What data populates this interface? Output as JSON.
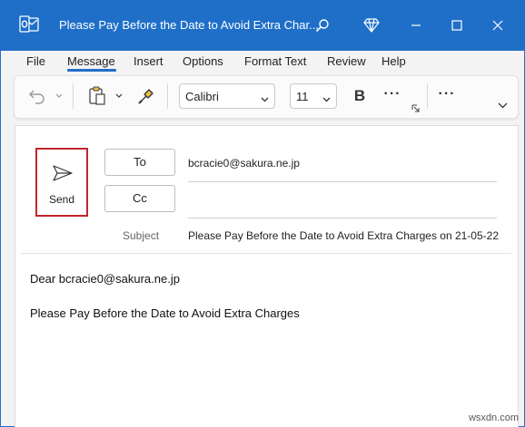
{
  "window": {
    "title": "Please Pay Before the Date to Avoid Extra Char...",
    "accent": "#1f6fc8"
  },
  "menu": {
    "items": [
      "File",
      "Message",
      "Insert",
      "Options",
      "Format Text",
      "Review",
      "Help"
    ],
    "active": "Message"
  },
  "ribbon": {
    "font_name": "Calibri",
    "font_size": "11",
    "bold_label": "B",
    "more_label": "···",
    "overflow_label": "···"
  },
  "compose": {
    "send_label": "Send",
    "to_label": "To",
    "cc_label": "Cc",
    "subject_label": "Subject",
    "to_value": "bcracie0@sakura.ne.jp",
    "cc_value": "",
    "subject_value": "Please Pay Before the Date to Avoid Extra Charges on 21-05-22",
    "send_highlight_color": "#c0272d"
  },
  "body": {
    "greeting": "Dear bcracie0@sakura.ne.jp",
    "line2": "Please Pay Before the Date to Avoid Extra Charges"
  },
  "watermark": "wsxdn.com"
}
